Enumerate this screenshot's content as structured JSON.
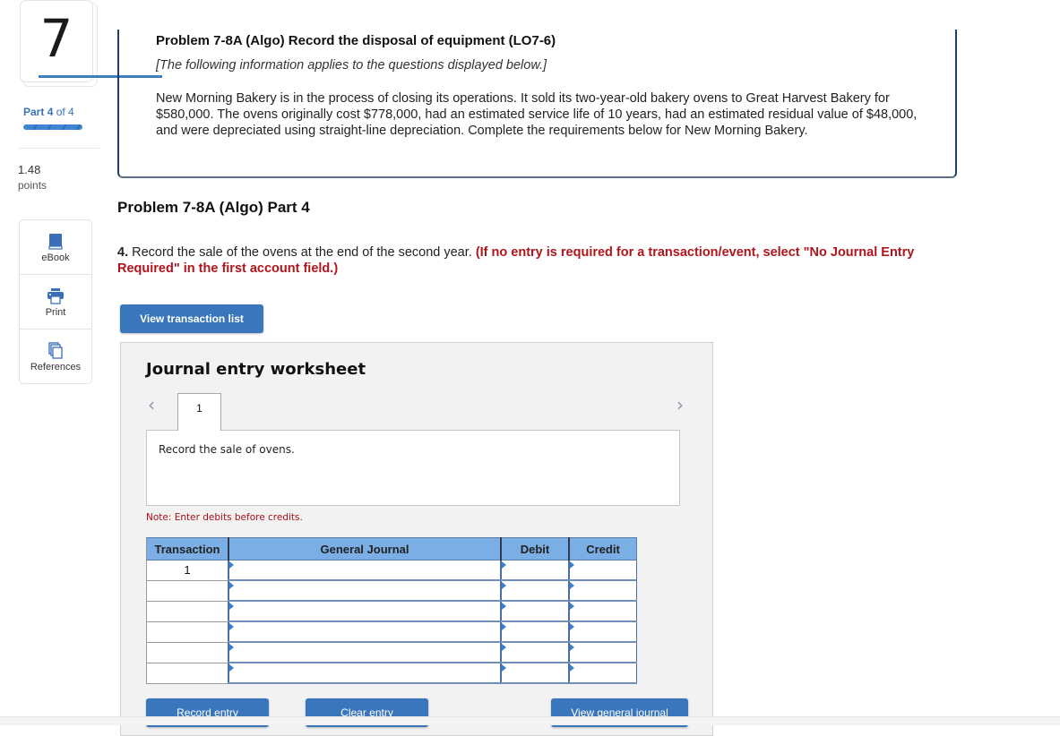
{
  "question": {
    "number": "7",
    "part_prefix": "Part",
    "part_current": "4",
    "part_suffix": "of 4",
    "part_progress": 1.0,
    "points_value": "1.48",
    "points_label": "points"
  },
  "tools": [
    {
      "label": "eBook",
      "icon": "book-icon"
    },
    {
      "label": "Print",
      "icon": "printer-icon"
    },
    {
      "label": "References",
      "icon": "documents-icon"
    }
  ],
  "intro": {
    "title": "Problem 7-8A (Algo) Record the disposal of equipment (LO7-6)",
    "subtitle": "[The following information applies to the questions displayed below.]",
    "body": "New Morning Bakery is in the process of closing its operations. It sold its two-year-old bakery ovens to Great Harvest Bakery for $580,000. The ovens originally cost $778,000, had an estimated service life of 10 years, had an estimated residual value of $48,000, and were depreciated using straight-line depreciation. Complete the requirements below for New Morning Bakery."
  },
  "part_heading": "Problem 7-8A (Algo) Part 4",
  "instruction": {
    "number": "4.",
    "text": " Record the sale of the ovens at the end of the second year. ",
    "note": "(If no entry is required for a transaction/event, select \"No Journal Entry Required\" in the first account field.)"
  },
  "buttons": {
    "view_transaction_list": "View transaction list",
    "record_entry": "Record entry",
    "clear_entry": "Clear entry",
    "view_general_journal": "View general journal"
  },
  "worksheet": {
    "title": "Journal entry worksheet",
    "prev_icon": "chevron-left-icon",
    "next_icon": "chevron-right-icon",
    "tabs": [
      "1"
    ],
    "active_tab": "1",
    "description": "Record the sale of ovens.",
    "note": "Note: Enter debits before credits.",
    "columns": [
      "Transaction",
      "General Journal",
      "Debit",
      "Credit"
    ],
    "rows": [
      {
        "transaction": "1",
        "account": "",
        "debit": "",
        "credit": ""
      },
      {
        "transaction": "",
        "account": "",
        "debit": "",
        "credit": ""
      },
      {
        "transaction": "",
        "account": "",
        "debit": "",
        "credit": ""
      },
      {
        "transaction": "",
        "account": "",
        "debit": "",
        "credit": ""
      },
      {
        "transaction": "",
        "account": "",
        "debit": "",
        "credit": ""
      },
      {
        "transaction": "",
        "account": "",
        "debit": "",
        "credit": ""
      }
    ]
  },
  "colors": {
    "accent": "#3a76bb",
    "header_blue": "#7aaee4",
    "warning_red": "#b0141c",
    "navy_border": "#1d3f6e"
  }
}
